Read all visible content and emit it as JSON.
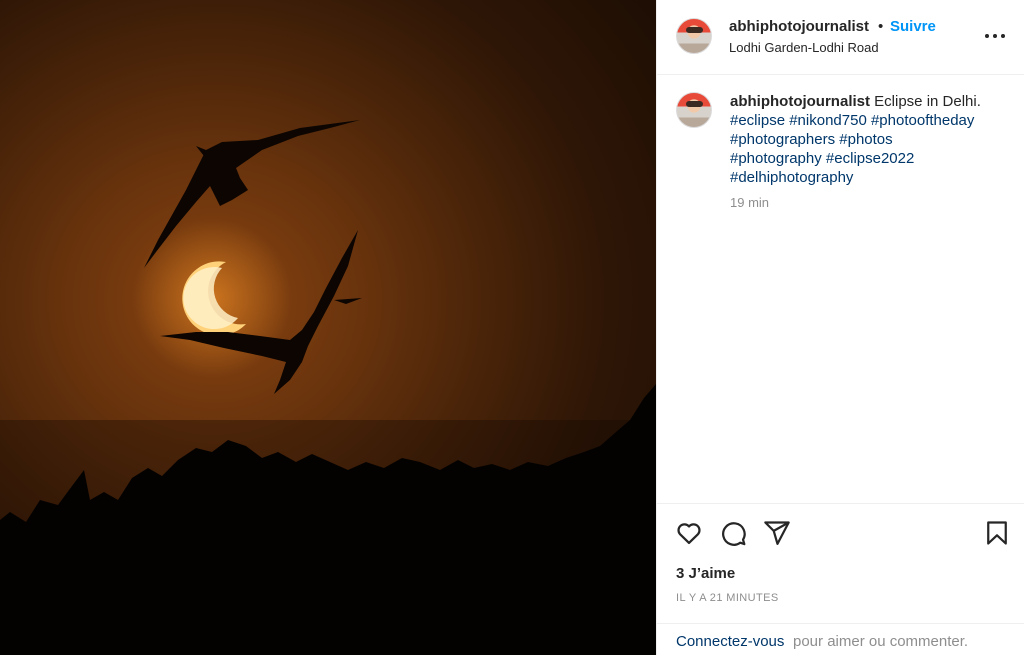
{
  "post": {
    "image": {
      "subject": "eclipse-birds-photo"
    },
    "header": {
      "username": "abhiphotojournalist",
      "separator": "•",
      "follow_label": "Suivre",
      "location": "Lodhi Garden-Lodhi Road"
    },
    "caption": {
      "username": "abhiphotojournalist",
      "text": "Eclipse in Delhi.",
      "hashtags": [
        "#eclipse",
        "#nikond750",
        "#photooftheday",
        "#photographers",
        "#photos",
        "#photography",
        "#eclipse2022",
        "#delhiphotography"
      ],
      "time": "19 min"
    },
    "actions": {
      "icons": [
        "heart-icon",
        "comment-icon",
        "share-icon",
        "bookmark-icon"
      ]
    },
    "likes_text": "3 J’aime",
    "timestamp": "IL Y A 21 MINUTES",
    "login_prompt": {
      "link": "Connectez-vous",
      "rest": "pour aimer ou commenter."
    },
    "colors": {
      "accent": "#0095f6",
      "hashtag": "#00376b",
      "secondary_text": "#8e8e8e",
      "sky": "#6a340d",
      "sun": "#ffd27a"
    }
  }
}
